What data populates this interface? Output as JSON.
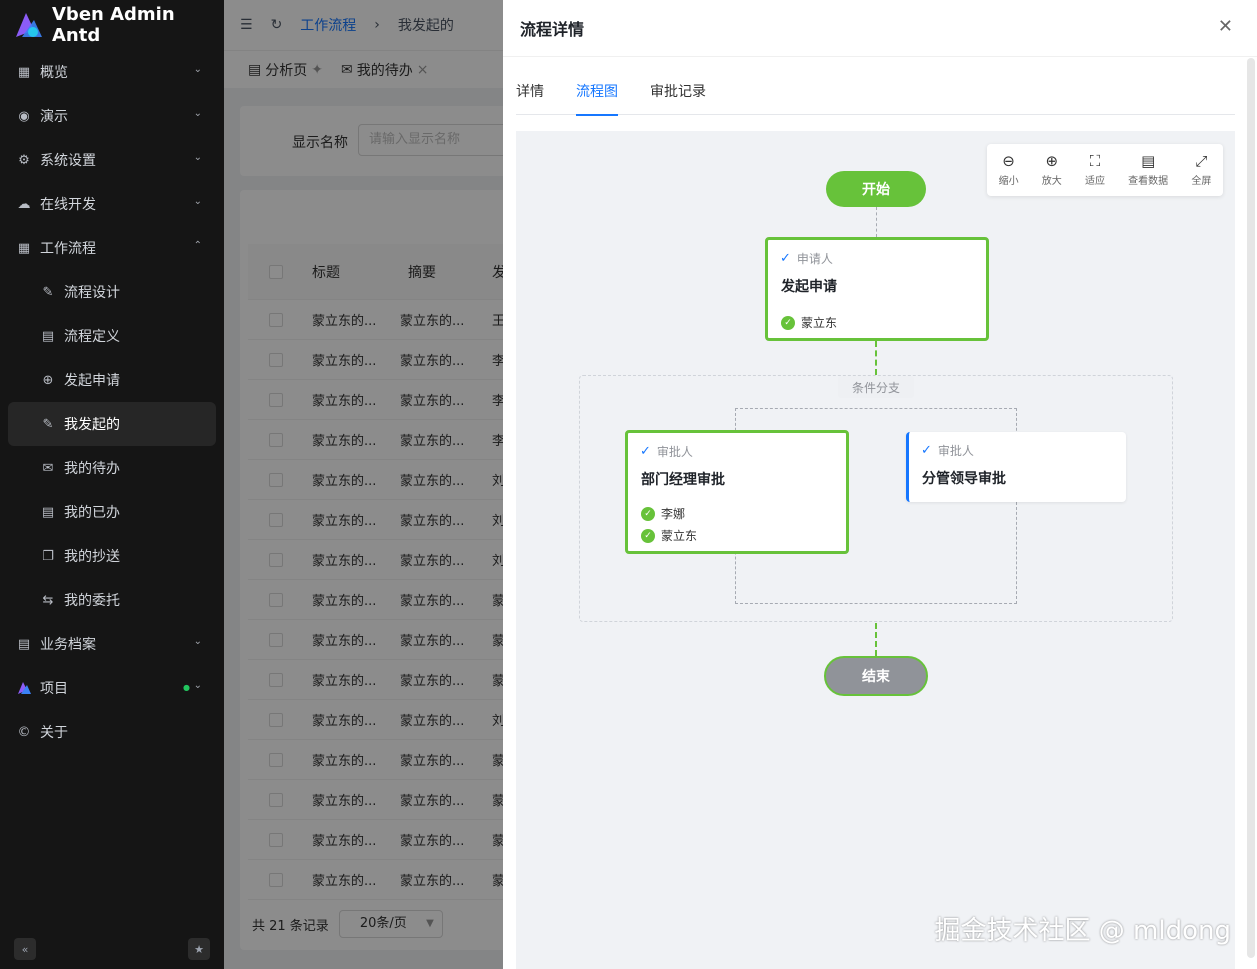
{
  "app": {
    "title": "Vben Admin Antd"
  },
  "sidebar": {
    "items": [
      {
        "label": "概览",
        "icon": "grid-icon",
        "expandable": true
      },
      {
        "label": "演示",
        "icon": "demo-icon",
        "expandable": true
      },
      {
        "label": "系统设置",
        "icon": "gear-icon",
        "expandable": true
      },
      {
        "label": "在线开发",
        "icon": "cloud-icon",
        "expandable": true
      },
      {
        "label": "工作流程",
        "icon": "workflow-icon",
        "expandable": true,
        "expanded": true
      }
    ],
    "workflow_children": [
      {
        "label": "流程设计",
        "icon": "design-icon"
      },
      {
        "label": "流程定义",
        "icon": "definition-icon"
      },
      {
        "label": "发起申请",
        "icon": "plus-circle-icon"
      },
      {
        "label": "我发起的",
        "icon": "edit-icon",
        "active": true
      },
      {
        "label": "我的待办",
        "icon": "mail-icon"
      },
      {
        "label": "我的已办",
        "icon": "book-icon"
      },
      {
        "label": "我的抄送",
        "icon": "copy-icon"
      },
      {
        "label": "我的委托",
        "icon": "swap-icon"
      }
    ],
    "tail_items": [
      {
        "label": "业务档案",
        "icon": "archive-icon",
        "expandable": true
      },
      {
        "label": "项目",
        "icon": "logo-icon",
        "expandable": true
      },
      {
        "label": "关于",
        "icon": "copyright-icon",
        "expandable": false
      }
    ]
  },
  "header": {
    "breadcrumb": [
      "工作流程",
      "我发起的"
    ]
  },
  "tabs": [
    {
      "label": "分析页"
    },
    {
      "label": "我的待办"
    }
  ],
  "search": {
    "label": "显示名称",
    "placeholder": "请输入显示名称"
  },
  "table": {
    "columns": [
      "标题",
      "摘要",
      "发"
    ],
    "rows": [
      [
        "蒙立东的...",
        "蒙立东的...",
        "王"
      ],
      [
        "蒙立东的...",
        "蒙立东的...",
        "李"
      ],
      [
        "蒙立东的...",
        "蒙立东的...",
        "李"
      ],
      [
        "蒙立东的...",
        "蒙立东的...",
        "李"
      ],
      [
        "蒙立东的...",
        "蒙立东的...",
        "刘"
      ],
      [
        "蒙立东的...",
        "蒙立东的...",
        "刘"
      ],
      [
        "蒙立东的...",
        "蒙立东的...",
        "刘"
      ],
      [
        "蒙立东的...",
        "蒙立东的...",
        "蒙"
      ],
      [
        "蒙立东的...",
        "蒙立东的...",
        "蒙"
      ],
      [
        "蒙立东的...",
        "蒙立东的...",
        "蒙"
      ],
      [
        "蒙立东的...",
        "蒙立东的...",
        "刘"
      ],
      [
        "蒙立东的...",
        "蒙立东的...",
        "蒙"
      ],
      [
        "蒙立东的...",
        "蒙立东的...",
        "蒙"
      ],
      [
        "蒙立东的...",
        "蒙立东的...",
        "蒙"
      ],
      [
        "蒙立东的...",
        "蒙立东的...",
        "蒙"
      ]
    ],
    "total": "共 21 条记录",
    "page_size": "20条/页"
  },
  "drawer": {
    "title": "流程详情",
    "tabs": [
      {
        "label": "详情"
      },
      {
        "label": "流程图",
        "active": true
      },
      {
        "label": "审批记录"
      }
    ],
    "toolbar": [
      {
        "label": "缩小",
        "icon": "zoom-out-icon"
      },
      {
        "label": "放大",
        "icon": "zoom-in-icon"
      },
      {
        "label": "适应",
        "icon": "fit-icon"
      },
      {
        "label": "查看数据",
        "icon": "document-icon"
      },
      {
        "label": "全屏",
        "icon": "fullscreen-icon"
      }
    ],
    "flow": {
      "start": "开始",
      "end": "结束",
      "applicant": {
        "role": "申请人",
        "title": "发起申请",
        "persons": [
          "蒙立东"
        ],
        "status": "done"
      },
      "branch_label": "条件分支",
      "approver_left": {
        "role": "审批人",
        "title": "部门经理审批",
        "persons": [
          "李娜",
          "蒙立东"
        ],
        "status": "done"
      },
      "approver_right": {
        "role": "审批人",
        "title": "分管领导审批",
        "persons": [],
        "status": "pending"
      }
    },
    "colors": {
      "done": "#67c23a",
      "pending": "#1677ff",
      "end_fill": "#909399"
    }
  },
  "watermark": "掘金技术社区 @ mldong"
}
